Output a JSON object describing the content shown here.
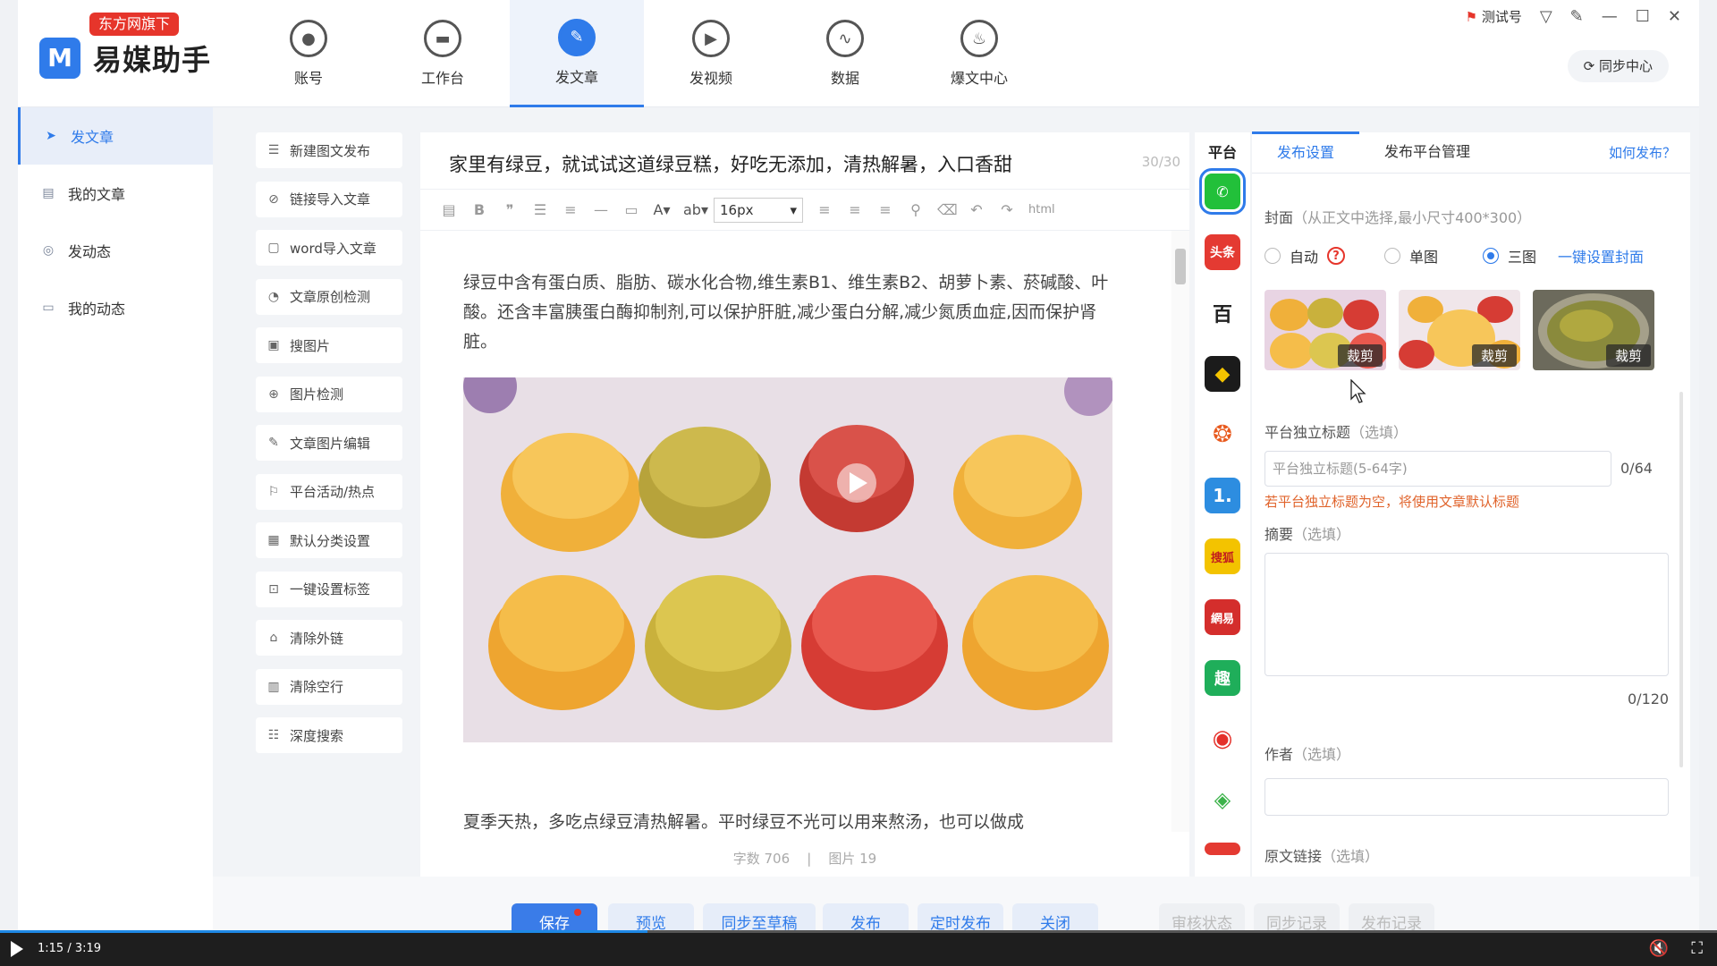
{
  "header": {
    "badge": "东方网旗下",
    "logo_letter": "M",
    "app_name": "易媒助手",
    "nav": [
      {
        "label": "账号",
        "icon": "account-icon"
      },
      {
        "label": "工作台",
        "icon": "workbench-icon"
      },
      {
        "label": "发文章",
        "icon": "feather-icon"
      },
      {
        "label": "发视频",
        "icon": "play-icon"
      },
      {
        "label": "数据",
        "icon": "chart-icon"
      },
      {
        "label": "爆文中心",
        "icon": "fire-icon"
      }
    ],
    "active_nav": "发文章",
    "account_name": "测试号",
    "sync_center": "同步中心"
  },
  "sidebar": {
    "items": [
      {
        "label": "发文章",
        "icon": "send-icon",
        "active": true
      },
      {
        "label": "我的文章",
        "icon": "doc-icon",
        "active": false
      },
      {
        "label": "发动态",
        "icon": "target-icon",
        "active": false
      },
      {
        "label": "我的动态",
        "icon": "list-icon",
        "active": false
      }
    ]
  },
  "tools": [
    {
      "label": "新建图文发布",
      "icon": "new-icon"
    },
    {
      "label": "链接导入文章",
      "icon": "link-icon"
    },
    {
      "label": "word导入文章",
      "icon": "word-icon"
    },
    {
      "label": "文章原创检测",
      "icon": "check-icon"
    },
    {
      "label": "搜图片",
      "icon": "image-search-icon"
    },
    {
      "label": "图片检测",
      "icon": "zoom-icon"
    },
    {
      "label": "文章图片编辑",
      "icon": "edit-icon"
    },
    {
      "label": "平台活动/热点",
      "icon": "flag-icon"
    },
    {
      "label": "默认分类设置",
      "icon": "grid-icon"
    },
    {
      "label": "一键设置标签",
      "icon": "tag-icon"
    },
    {
      "label": "清除外链",
      "icon": "unlink-icon"
    },
    {
      "label": "清除空行",
      "icon": "trash-icon"
    },
    {
      "label": "深度搜索",
      "icon": "search-icon"
    }
  ],
  "editor": {
    "title": "家里有绿豆，就试试这道绿豆糕，好吃无添加，清热解暑，入口香甜",
    "title_count": "30/30",
    "font_size": "16px",
    "html_label": "html",
    "paragraph1": "绿豆中含有蛋白质、脂肪、碳水化合物,维生素B1、维生素B2、胡萝卜素、菸碱酸、叶酸。还含丰富胰蛋白酶抑制剂,可以保护肝脏,减少蛋白分解,减少氮质血症,因而保护肾脏。",
    "paragraph2": "夏季天热，多吃点绿豆清热解暑。平时绿豆不光可以用来熬汤，也可以做成",
    "word_count": "字数 706",
    "separator": "|",
    "image_count": "图片 19"
  },
  "platforms": {
    "header": "平台",
    "icons": [
      {
        "name": "wechat-icon",
        "text": "",
        "color": "#22c03a"
      },
      {
        "name": "toutiao-icon",
        "text": "头条",
        "color": "#e43a32"
      },
      {
        "name": "baidu-icon",
        "text": "百",
        "color": "#ffffff"
      },
      {
        "name": "qq-icon",
        "text": "",
        "color": "#1b1b1b"
      },
      {
        "name": "dayu-icon",
        "text": "",
        "color": "#ffffff"
      },
      {
        "name": "yidian-icon",
        "text": "1.",
        "color": "#2d8de0"
      },
      {
        "name": "sohu-icon",
        "text": "搜狐",
        "color": "#f3c300"
      },
      {
        "name": "netease-icon",
        "text": "網易",
        "color": "#d42e2c"
      },
      {
        "name": "qutoutiao-icon",
        "text": "趣",
        "color": "#1fae5a"
      },
      {
        "name": "weibo-icon",
        "text": "",
        "color": "#ffffff"
      },
      {
        "name": "iqiyi-icon",
        "text": "",
        "color": "#ffffff"
      },
      {
        "name": "more-icon",
        "text": "",
        "color": "#e43a32"
      }
    ]
  },
  "settings": {
    "tabs": [
      "发布设置",
      "发布平台管理"
    ],
    "help": "如何发布？",
    "cover_label": "封面",
    "cover_hint": "（从正文中选择,最小尺寸400*300）",
    "radio_auto": "自动",
    "radio_single": "单图",
    "radio_triple": "三图",
    "cover_selected": "三图",
    "one_click_cover": "一键设置封面",
    "crop": "裁剪",
    "title_label": "平台独立标题",
    "optional": "（选填）",
    "title_placeholder": "平台独立标题(5-64字)",
    "title_counter": "0/64",
    "title_warning": "若平台独立标题为空，将使用文章默认标题",
    "summary_label": "摘要",
    "summary_counter": "0/120",
    "author_label": "作者",
    "source_label": "原文链接"
  },
  "bottom": {
    "buttons": [
      "保存",
      "预览",
      "同步至草稿",
      "发布",
      "定时发布",
      "关闭"
    ],
    "gray_buttons": [
      "审核状态",
      "同步记录",
      "发布记录"
    ]
  },
  "video": {
    "time": "1:15 / 3:19",
    "progress": 0.377
  },
  "colors": {
    "accent": "#2f7bea",
    "brand_red": "#e6352b",
    "warning": "#e0632b"
  }
}
